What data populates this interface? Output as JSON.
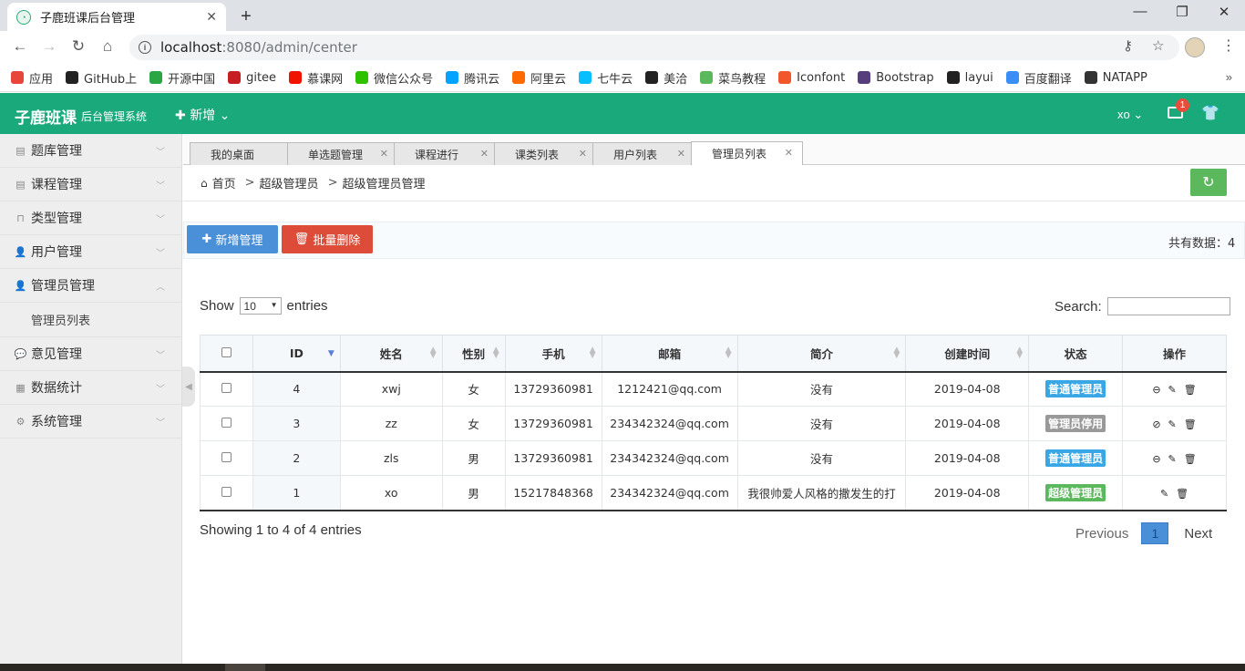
{
  "browser": {
    "tab_title": "子鹿班课后台管理",
    "url_host": "localhost",
    "url_path": ":8080/admin/center",
    "bookmarks": [
      {
        "label": "应用",
        "color": "#e8453c",
        "icon": "apps-icon"
      },
      {
        "label": "GitHub上",
        "color": "#222222",
        "icon": "github-icon"
      },
      {
        "label": "开源中国",
        "color": "#2aa744",
        "icon": "oschina-icon"
      },
      {
        "label": "gitee",
        "color": "#c71d23",
        "icon": "gitee-icon"
      },
      {
        "label": "慕课网",
        "color": "#f01400",
        "icon": "imooc-icon"
      },
      {
        "label": "微信公众号",
        "color": "#2dc100",
        "icon": "wechat-icon"
      },
      {
        "label": "腾讯云",
        "color": "#00a3ff",
        "icon": "tencent-cloud-icon"
      },
      {
        "label": "阿里云",
        "color": "#ff6a00",
        "icon": "aliyun-icon"
      },
      {
        "label": "七牛云",
        "color": "#07beff",
        "icon": "qiniu-icon"
      },
      {
        "label": "美洽",
        "color": "#222222",
        "icon": "meiqia-icon"
      },
      {
        "label": "菜鸟教程",
        "color": "#5cb85c",
        "icon": "runoob-icon"
      },
      {
        "label": "Iconfont",
        "color": "#f2572c",
        "icon": "iconfont-icon"
      },
      {
        "label": "Bootstrap",
        "color": "#563d7c",
        "icon": "bootstrap-icon"
      },
      {
        "label": "layui",
        "color": "#222222",
        "icon": "layui-icon"
      },
      {
        "label": "百度翻译",
        "color": "#3c8ef7",
        "icon": "baidu-translate-icon"
      },
      {
        "label": "NATAPP",
        "color": "#333333",
        "icon": "natapp-icon"
      }
    ]
  },
  "header": {
    "logo": "子鹿班课",
    "subtitle": "后台管理系统",
    "add_menu": "新增",
    "user": "xo",
    "msg_count": "1",
    "brand_color": "#1aa97b"
  },
  "sidebar": {
    "items": [
      {
        "label": "题库管理",
        "icon": "list-icon"
      },
      {
        "label": "课程管理",
        "icon": "list-icon"
      },
      {
        "label": "类型管理",
        "icon": "briefcase-icon"
      },
      {
        "label": "用户管理",
        "icon": "user-icon"
      },
      {
        "label": "管理员管理",
        "icon": "user-icon",
        "expanded": true,
        "children": [
          "管理员列表"
        ]
      },
      {
        "label": "意见管理",
        "icon": "comment-icon"
      },
      {
        "label": "数据统计",
        "icon": "chart-icon"
      },
      {
        "label": "系统管理",
        "icon": "gear-icon"
      }
    ]
  },
  "content_tabs": [
    "我的桌面",
    "单选题管理",
    "课程进行",
    "课类列表",
    "用户列表",
    "管理员列表"
  ],
  "breadcrumb": [
    "首页",
    "超级管理员",
    "超级管理员管理"
  ],
  "actions": {
    "add": "新增管理",
    "batch_delete": "批量删除",
    "total_label": "共有数据：",
    "total_value": "4"
  },
  "datatable": {
    "show_label": "Show",
    "page_length": "10",
    "entries_label": "entries",
    "search_label": "Search:",
    "info": "Showing 1 to 4 of 4 entries",
    "prev": "Previous",
    "current_page": "1",
    "next": "Next"
  },
  "table": {
    "columns": [
      "ID",
      "姓名",
      "性别",
      "手机",
      "邮箱",
      "简介",
      "创建时间",
      "状态",
      "操作"
    ],
    "rows": [
      {
        "id": "4",
        "name": "xwj",
        "gender": "女",
        "phone": "13729360981",
        "email": "1212421@qq.com",
        "intro": "没有",
        "created": "2019-04-08",
        "status": "普通管理员",
        "status_color": "#39a7e6",
        "toggle": "disable"
      },
      {
        "id": "3",
        "name": "zz",
        "gender": "女",
        "phone": "13729360981",
        "email": "234342324@qq.com",
        "intro": "没有",
        "created": "2019-04-08",
        "status": "管理员停用",
        "status_color": "#999999",
        "toggle": "enable"
      },
      {
        "id": "2",
        "name": "zls",
        "gender": "男",
        "phone": "13729360981",
        "email": "234342324@qq.com",
        "intro": "没有",
        "created": "2019-04-08",
        "status": "普通管理员",
        "status_color": "#39a7e6",
        "toggle": "disable"
      },
      {
        "id": "1",
        "name": "xo",
        "gender": "男",
        "phone": "15217848368",
        "email": "234342324@qq.com",
        "intro": "我很帅爱人风格的撒发生的打",
        "created": "2019-04-08",
        "status": "超级管理员",
        "status_color": "#5cb85c",
        "toggle": "none"
      }
    ]
  }
}
